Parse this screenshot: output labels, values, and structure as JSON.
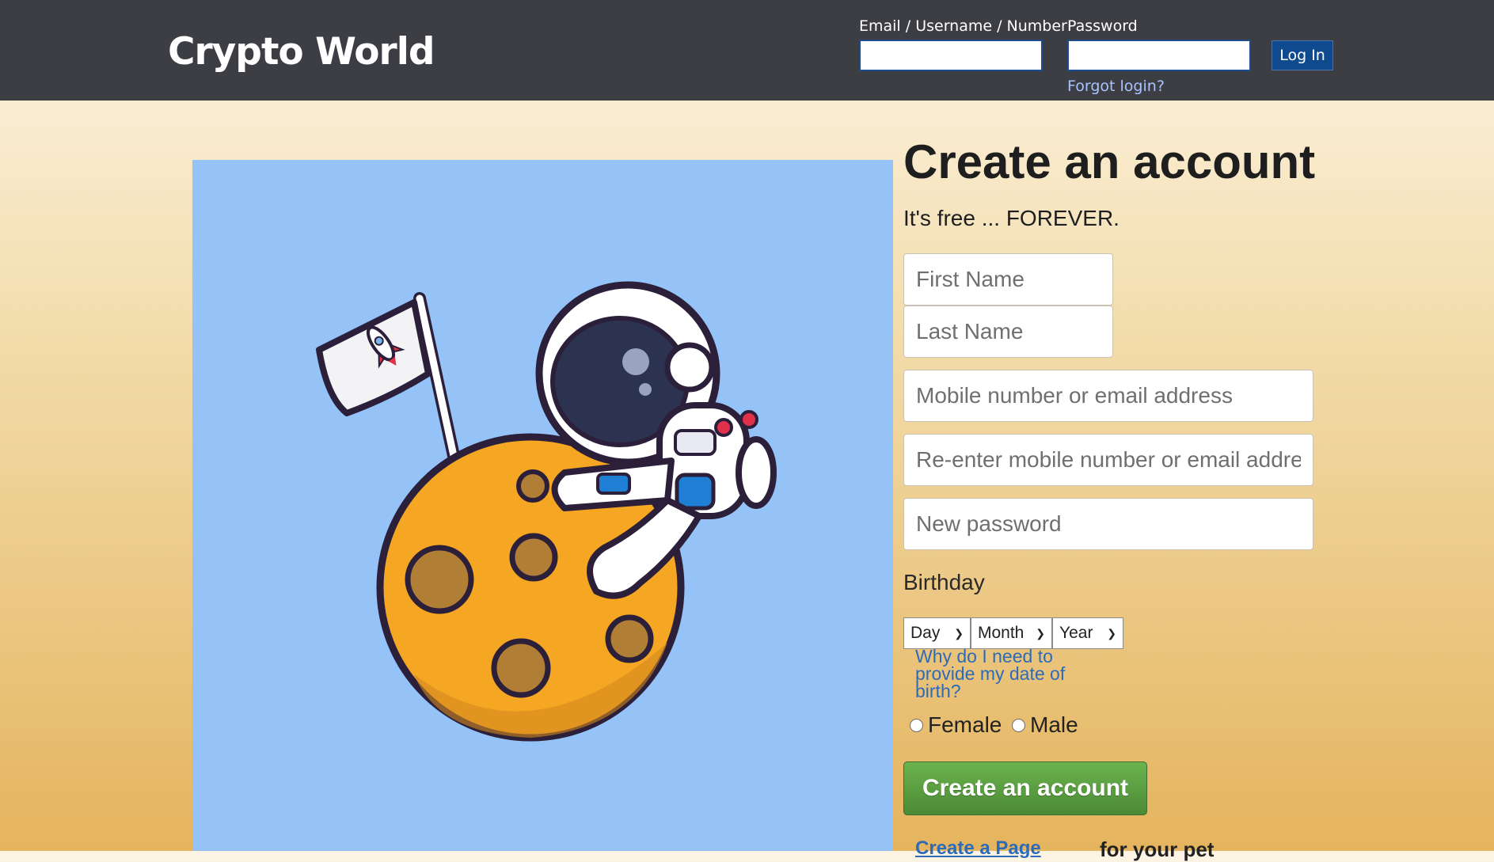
{
  "header": {
    "logo": "Crypto World",
    "email_label": "Email / Username / Number",
    "password_label": "Password",
    "login_button": "Log In",
    "forgot_link": "Forgot login?"
  },
  "signup": {
    "title": "Create an account",
    "subtitle": "It's free ... FOREVER.",
    "first_name_placeholder": "First Name",
    "last_name_placeholder": "Last Name",
    "contact_placeholder": "Mobile number or email address",
    "contact_confirm_placeholder": "Re-enter mobile number or email address",
    "password_placeholder": "New password",
    "birthday_label": "Birthday",
    "day_select": "Day",
    "month_select": "Month",
    "year_select": "Year",
    "why_birthday_link": "Why do I need to provide my date of birth?",
    "gender_female": "Female",
    "gender_male": "Male",
    "submit_button": "Create an account",
    "create_page_link": "Create a Page",
    "create_page_suffix": "for your pet"
  },
  "hero": {
    "illustration": "astronaut-on-moon-with-rocket-flag"
  },
  "colors": {
    "header_bg": "#3d3e43",
    "hero_bg": "#95c3f8",
    "submit_green": "#5a9e40",
    "link_blue": "#2d6bb8"
  }
}
